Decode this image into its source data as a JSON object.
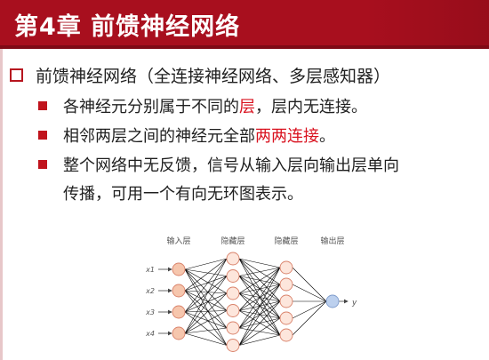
{
  "title": "第4章  前馈神经网络",
  "main_bullet": "前馈神经网络（全连接神经网络、多层感知器）",
  "bullets": [
    {
      "pre": "各神经元分别属于不同的",
      "hi": "层",
      "post": "，层内无连接。"
    },
    {
      "pre": "相邻两层之间的神经元全部",
      "hi": "两两连接",
      "post": "。"
    },
    {
      "line1": "整个网络中无反馈，信号从输入层向输出层单向",
      "line2": "传播，可用一个有向无环图表示。"
    }
  ],
  "diagram": {
    "layer_labels": [
      "输入层",
      "隐藏层",
      "隐藏层",
      "输出层"
    ],
    "input_labels": [
      "x1",
      "x2",
      "x3",
      "x4"
    ],
    "output_label": "y",
    "layer_sizes": [
      4,
      6,
      5,
      1
    ],
    "colors": {
      "input": "#f6c6ad",
      "hidden": "#fde6dc",
      "output": "#bcd0ee",
      "edge": "#000000"
    }
  }
}
